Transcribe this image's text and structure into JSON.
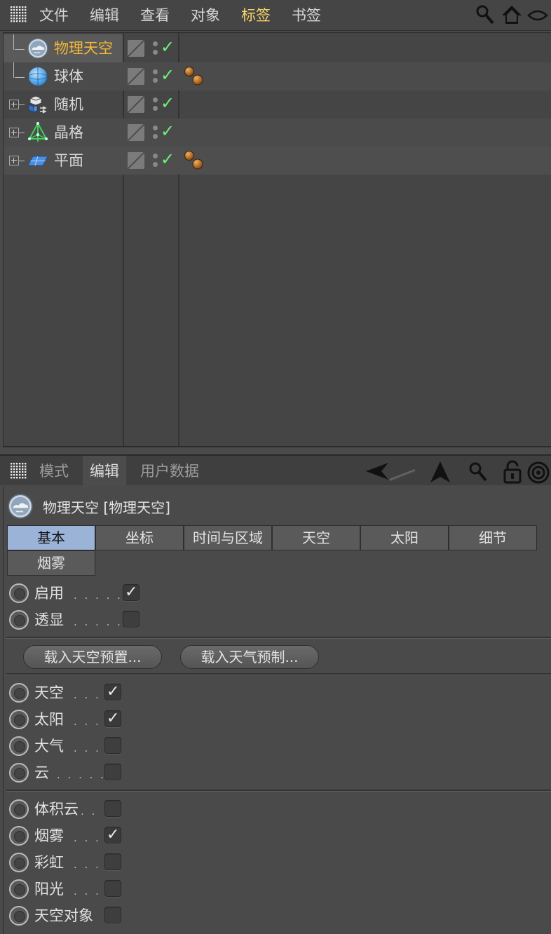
{
  "menubar": {
    "items": [
      "文件",
      "编辑",
      "查看",
      "对象",
      "标签",
      "书签"
    ],
    "active_index": 4,
    "icons": [
      "grid-menu-icon",
      "search-icon",
      "home-icon",
      "eye-icon"
    ]
  },
  "objects": [
    {
      "name": "物理天空",
      "icon": "physical-sky-icon",
      "selected": true,
      "expandable": false,
      "has_tag": false
    },
    {
      "name": "球体",
      "icon": "sphere-icon",
      "selected": false,
      "expandable": false,
      "has_tag": true
    },
    {
      "name": "随机",
      "icon": "random-effector-icon",
      "selected": false,
      "expandable": true,
      "has_tag": false
    },
    {
      "name": "晶格",
      "icon": "lattice-icon",
      "selected": false,
      "expandable": true,
      "has_tag": false
    },
    {
      "name": "平面",
      "icon": "plane-icon",
      "selected": false,
      "expandable": true,
      "has_tag": true
    }
  ],
  "attr_bar": {
    "tabs": [
      "模式",
      "编辑",
      "用户数据"
    ],
    "active_index": 1,
    "icons": [
      "grid-menu-icon",
      "back-arrow-icon",
      "up-arrow-icon",
      "search-icon",
      "lock-icon",
      "target-icon"
    ]
  },
  "attr": {
    "title": "物理天空 [物理天空]",
    "tabs": [
      "基本",
      "坐标",
      "时间与区域",
      "天空",
      "太阳",
      "细节",
      "烟雾"
    ],
    "active_tab": 0,
    "group1": [
      {
        "label": "启用",
        "dots": ". . . . .",
        "checked": true
      },
      {
        "label": "透显",
        "dots": ". . . . .",
        "checked": false
      }
    ],
    "buttons": [
      "载入天空预置...",
      "载入天气预制..."
    ],
    "group2": [
      {
        "label": "天空",
        "dots": ". . .",
        "checked": true
      },
      {
        "label": "太阳",
        "dots": ". . .",
        "checked": true
      },
      {
        "label": "大气",
        "dots": ". . .",
        "checked": false
      },
      {
        "label": "云",
        "dots": ". . . . .",
        "checked": false
      }
    ],
    "group3": [
      {
        "label": "体积云",
        "dots": ". .",
        "checked": false
      },
      {
        "label": "烟雾",
        "dots": ". . .",
        "checked": true
      },
      {
        "label": "彩虹",
        "dots": ". . .",
        "checked": false
      },
      {
        "label": "阳光",
        "dots": ". . .",
        "checked": false
      },
      {
        "label": "天空对象",
        "dots": "",
        "checked": false
      }
    ]
  },
  "colors": {
    "active_menu": "#f5d46a",
    "selected_object": "#f2b736",
    "visibility_check": "#6ef07a",
    "active_tab": "#9ab3d6"
  }
}
